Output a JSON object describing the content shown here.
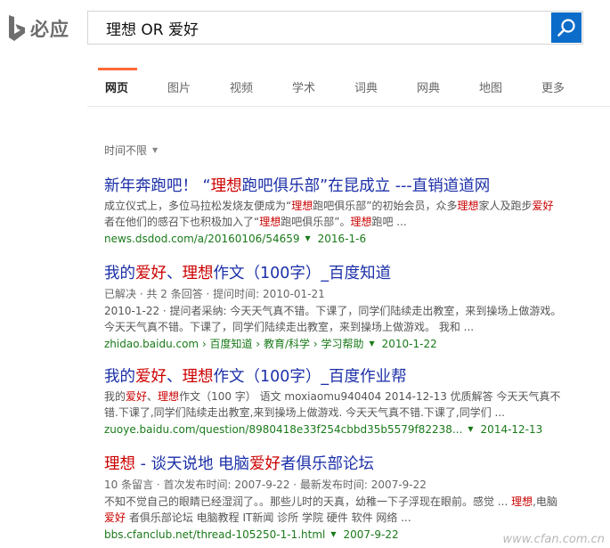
{
  "brand": {
    "name": "必应"
  },
  "search": {
    "query": "理想 OR 爱好"
  },
  "tabs": [
    {
      "label": "网页",
      "active": true
    },
    {
      "label": "图片"
    },
    {
      "label": "视频"
    },
    {
      "label": "学术"
    },
    {
      "label": "词典"
    },
    {
      "label": "网典"
    },
    {
      "label": "地图"
    },
    {
      "label": "更多"
    }
  ],
  "filter": {
    "label": "时间不限"
  },
  "results": [
    {
      "title": [
        [
          "新年奔跑吧！ “",
          false
        ],
        [
          "理想",
          true
        ],
        [
          "跑吧俱乐部”在昆成立 ---直销道道网",
          false
        ]
      ],
      "meta": "",
      "snippet": [
        [
          "成立仪式上，多位马拉松发烧友便成为“",
          false
        ],
        [
          "理想",
          true
        ],
        [
          "跑吧俱乐部”的初始会员，众多",
          false
        ],
        [
          "理想",
          true
        ],
        [
          "家人及跑步",
          false
        ],
        [
          "爱好",
          true
        ],
        [
          " 者在他们的感召下也积极加入了“",
          false
        ],
        [
          "理想",
          true
        ],
        [
          "跑吧俱乐部”。",
          false
        ],
        [
          "理想",
          true
        ],
        [
          "跑吧 ...",
          false
        ]
      ],
      "url": "news.dsdod.com/a/20160106/54659",
      "date": "2016-1-6"
    },
    {
      "title": [
        [
          "我的",
          false
        ],
        [
          "爱好",
          true
        ],
        [
          "、",
          false
        ],
        [
          "理想",
          true
        ],
        [
          "作文（100字）_百度知道",
          false
        ]
      ],
      "meta": "已解决 · 共 2 条回答 · 提问时间: 2010-01-21",
      "snippet": [
        [
          "2010-1-22 · 提问者采纳: 今天天气真不错。下课了，同学们陆续走出教室，来到操场上做游戏。 今天天气真不错。下课了，同学们陆续走出教室，来到操场上做游戏。 我和 ...",
          false
        ]
      ],
      "url": "zhidao.baidu.com › 百度知道 › 教育/科学 › 学习帮助",
      "date": "2010-1-22"
    },
    {
      "title": [
        [
          "我的",
          false
        ],
        [
          "爱好",
          true
        ],
        [
          "、",
          false
        ],
        [
          "理想",
          true
        ],
        [
          "作文（100字）_百度作业帮",
          false
        ]
      ],
      "meta": "",
      "snippet": [
        [
          "我的",
          false
        ],
        [
          "爱好",
          true
        ],
        [
          "、",
          false
        ],
        [
          "理想",
          true
        ],
        [
          "作文（100 字） 语文 moxiaomu940404 2014-12-13 优质解答 今天天气真不错.下课了,同学们陆续走出教室,来到操场上做游戏. 今天天气真不错.下课了,同学们 ...",
          false
        ]
      ],
      "url": "zuoye.baidu.com/question/8980418e33f254cbbd35b5579f82238...",
      "date": "2014-12-13"
    },
    {
      "title": [
        [
          "理想",
          true
        ],
        [
          " - 谈天说地 电脑",
          false
        ],
        [
          "爱好",
          true
        ],
        [
          "者俱乐部论坛",
          false
        ]
      ],
      "meta": "10 条留言 · 首次发布时间: 2007-9-22 · 最新发布时间: 2007-9-22",
      "snippet": [
        [
          "不知不觉自己的眼睛已经湿润了。。那些儿时的天真，幼稚一下子浮现在眼前。感觉 ... ",
          false
        ],
        [
          "理想",
          true
        ],
        [
          ",电脑",
          false
        ],
        [
          "爱好",
          true
        ],
        [
          " 者俱乐部论坛 电脑教程 IT新闻 诊所 学院 硬件 软件 网络 ...",
          false
        ]
      ],
      "url": "bbs.cfanclub.net/thread-105250-1-1.html",
      "date": "2007-9-22"
    }
  ],
  "watermark": "www.cfan.com.cn"
}
